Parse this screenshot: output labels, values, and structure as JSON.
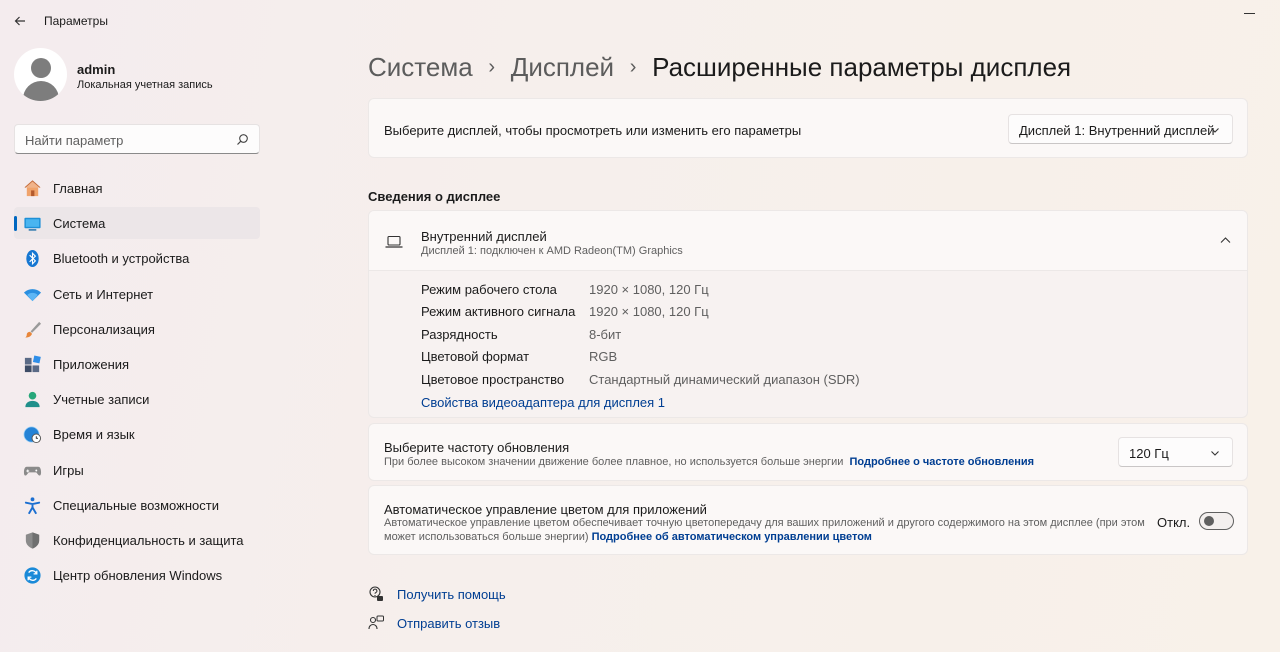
{
  "window": {
    "title": "Параметры"
  },
  "profile": {
    "name": "admin",
    "subtitle": "Локальная учетная запись"
  },
  "search": {
    "placeholder": "Найти параметр"
  },
  "nav": {
    "items": [
      {
        "label": "Главная",
        "icon": "home-icon"
      },
      {
        "label": "Система",
        "icon": "system-icon",
        "active": true
      },
      {
        "label": "Bluetooth и устройства",
        "icon": "bluetooth-icon"
      },
      {
        "label": "Сеть и Интернет",
        "icon": "wifi-icon"
      },
      {
        "label": "Персонализация",
        "icon": "brush-icon"
      },
      {
        "label": "Приложения",
        "icon": "apps-icon"
      },
      {
        "label": "Учетные записи",
        "icon": "accounts-icon"
      },
      {
        "label": "Время и язык",
        "icon": "globe-clock-icon"
      },
      {
        "label": "Игры",
        "icon": "gamepad-icon"
      },
      {
        "label": "Специальные возможности",
        "icon": "accessibility-icon"
      },
      {
        "label": "Конфиденциальность и защита",
        "icon": "shield-icon"
      },
      {
        "label": "Центр обновления Windows",
        "icon": "update-icon"
      }
    ]
  },
  "breadcrumb": {
    "items": [
      "Система",
      "Дисплей",
      "Расширенные параметры дисплея"
    ],
    "separator": "›"
  },
  "display_select": {
    "label": "Выберите дисплей, чтобы просмотреть или изменить его параметры",
    "value": "Дисплей 1: Внутренний дисплей"
  },
  "info": {
    "section_title": "Сведения о дисплее",
    "name": "Внутренний дисплей",
    "subtitle": "Дисплей 1: подключен к AMD Radeon(TM) Graphics",
    "rows": [
      {
        "label": "Режим рабочего стола",
        "value": "1920 × 1080, 120 Гц"
      },
      {
        "label": "Режим активного сигнала",
        "value": "1920 × 1080, 120 Гц"
      },
      {
        "label": "Разрядность",
        "value": "8-бит"
      },
      {
        "label": "Цветовой формат",
        "value": "RGB"
      },
      {
        "label": "Цветовое пространство",
        "value": "Стандартный динамический диапазон (SDR)"
      }
    ],
    "adapter_link": "Свойства видеоадаптера для дисплея 1"
  },
  "refresh": {
    "title": "Выберите частоту обновления",
    "desc": "При более высоком значении движение более плавное, но используется больше энергии",
    "link": "Подробнее о частоте обновления",
    "value": "120 Гц"
  },
  "color_mgmt": {
    "title": "Автоматическое управление цветом для приложений",
    "desc_line1": "Автоматическое управление цветом обеспечивает точную цветопередачу для ваших приложений и другого содержимого на этом дисплее (при этом",
    "desc_line2": "может использоваться больше энергии)",
    "link": "Подробнее об автоматическом управлении цветом",
    "toggle_label": "Откл.",
    "toggle_on": false
  },
  "footer": {
    "help": "Получить помощь",
    "feedback": "Отправить отзыв"
  },
  "colors": {
    "accent": "#0067c0",
    "link": "#003e92"
  }
}
